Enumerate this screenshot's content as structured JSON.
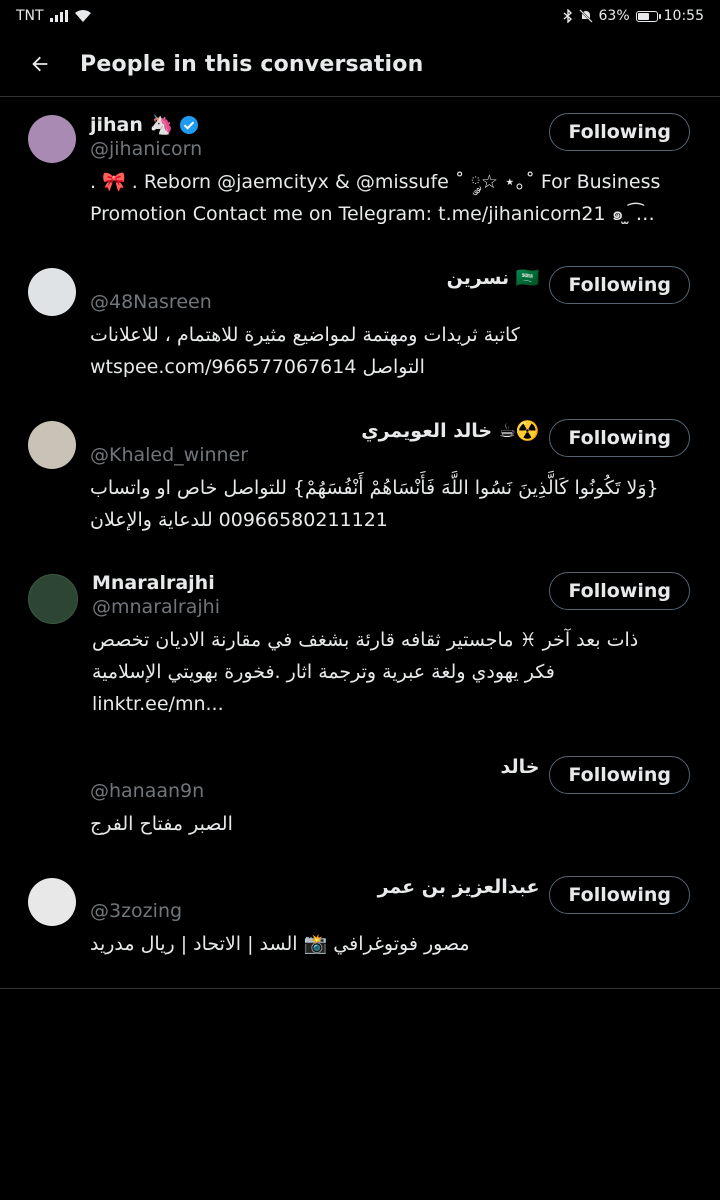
{
  "status_bar": {
    "carrier": "TNT",
    "battery": "63%",
    "battery_level": 0.63,
    "time": "10:55"
  },
  "header": {
    "title": "People in this conversation",
    "back_icon": "arrow-left-icon"
  },
  "people": [
    {
      "display_name": "jihan 🦄",
      "handle": "@jihanicorn",
      "verified": true,
      "button": "Following",
      "bio_lines": [
        ". 🎀 . Reborn @jaemcityx & @missufe ˚ ༘☆ ⋆｡˚ For Business",
        "Promotion Contact me on Telegram: t.me/jihanicorn21 ๑ ̫ ͡…"
      ],
      "rtl": false,
      "avatar_color": "#a98ab3"
    },
    {
      "display_name": "نسرين 🇸🇦",
      "handle": "@48Nasreen",
      "verified": false,
      "button": "Following",
      "bio_lines": [
        "كاتبة ثريدات ومهتمة لمواضيع مثيرة للاهتمام ، للاعلانات",
        "التواصل wtspee.com/966577067614"
      ],
      "rtl": true,
      "avatar_color": "#dfe3e6"
    },
    {
      "display_name": "خالد العويمري ☕☢️",
      "handle": "@Khaled_winner",
      "verified": false,
      "button": "Following",
      "bio_lines": [
        "{وَلا تَكُونُوا كَالَّذِينَ نَسُوا اللَّهَ فَأَنْسَاهُمْ أَنْفُسَهُمْ} للتواصل خاص او واتساب",
        "00966580211121 للدعاية والإعلان"
      ],
      "rtl": true,
      "avatar_color": "#c9c2b6"
    },
    {
      "display_name": "Mnaralrajhi",
      "handle": "@mnaralrajhi",
      "verified": false,
      "button": "Following",
      "bio_lines": [
        "ذات بعد آخر ♓ ماجستير ثقافه قارئة بشغف في مقارنة الاديان تخصص",
        "فكر يهودي ولغة عبرية وترجمة اثار .فخورة بهويتي الإسلامية ...linktr.ee/mn"
      ],
      "rtl": true,
      "avatar_color": "#2d4634"
    },
    {
      "display_name": "خالد",
      "handle": "@hanaan9n",
      "verified": false,
      "button": "Following",
      "bio_lines": [
        "الصبر مفتاح الفرج"
      ],
      "rtl": true,
      "avatar_color": "#000000"
    },
    {
      "display_name": "عبدالعزيز بن عمر",
      "handle": "@3zozing",
      "verified": false,
      "button": "Following",
      "bio_lines": [
        "مصور فوتوغرافي 📸 السد | الاتحاد | ريال مدريد"
      ],
      "rtl": true,
      "avatar_color": "#e8e8e8"
    }
  ]
}
